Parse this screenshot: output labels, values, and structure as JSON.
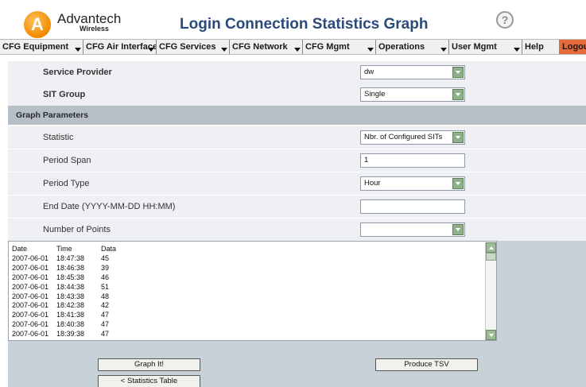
{
  "header": {
    "logo_letter": "A",
    "logo_name": "Advantech",
    "logo_sub": "Wireless",
    "title": "Login Connection Statistics Graph",
    "help_symbol": "?"
  },
  "nav": {
    "items": [
      {
        "label": "CFG Equipment",
        "has_dropdown": true
      },
      {
        "label": "CFG Air Interface",
        "has_dropdown": true
      },
      {
        "label": "CFG Services",
        "has_dropdown": true
      },
      {
        "label": "CFG Network",
        "has_dropdown": true
      },
      {
        "label": "CFG Mgmt",
        "has_dropdown": true
      },
      {
        "label": "Operations",
        "has_dropdown": true
      },
      {
        "label": "User Mgmt",
        "has_dropdown": true
      },
      {
        "label": "Help",
        "has_dropdown": false
      },
      {
        "label": "Logout",
        "has_dropdown": false
      }
    ],
    "logout_color": "#e66a3a"
  },
  "form": {
    "service_provider": {
      "label": "Service Provider",
      "value": "dw"
    },
    "sit_group": {
      "label": "SIT Group",
      "value": "Single"
    },
    "section_title": "Graph Parameters",
    "statistic": {
      "label": "Statistic",
      "value": "Nbr. of Configured SITs"
    },
    "period_span": {
      "label": "Period Span",
      "value": "1"
    },
    "period_type": {
      "label": "Period Type",
      "value": "Hour"
    },
    "end_date": {
      "label": "End Date (YYYY-MM-DD HH:MM)",
      "value": ""
    },
    "num_points": {
      "label": "Number of Points",
      "value": ""
    }
  },
  "data_table": {
    "headers": [
      "Date",
      "Time",
      "Data"
    ],
    "rows": [
      [
        "2007-06-01",
        "18:47:38",
        "45"
      ],
      [
        "2007-06-01",
        "18:46:38",
        "39"
      ],
      [
        "2007-06-01",
        "18:45:38",
        "46"
      ],
      [
        "2007-06-01",
        "18:44:38",
        "51"
      ],
      [
        "2007-06-01",
        "18:43:38",
        "48"
      ],
      [
        "2007-06-01",
        "18:42:38",
        "42"
      ],
      [
        "2007-06-01",
        "18:41:38",
        "47"
      ],
      [
        "2007-06-01",
        "18:40:38",
        "47"
      ],
      [
        "2007-06-01",
        "18:39:38",
        "47"
      ]
    ]
  },
  "buttons": {
    "graph_it": "Graph It!",
    "produce_tsv": "Produce TSV",
    "statistics_table": "< Statistics Table"
  }
}
